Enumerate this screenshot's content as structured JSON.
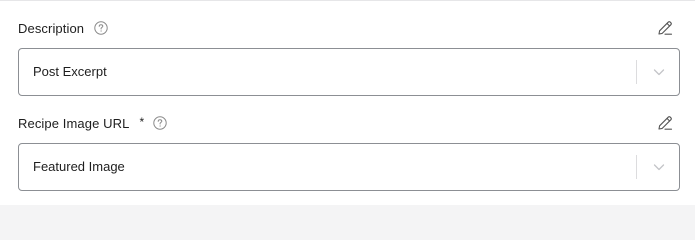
{
  "fields": [
    {
      "label": "Description",
      "required": false,
      "value": "Post Excerpt",
      "help_icon": "question-circle-icon",
      "edit_icon": "pencil-icon",
      "dropdown_icon": "chevron-down-icon"
    },
    {
      "label": "Recipe Image URL",
      "required": true,
      "required_marker": "*",
      "value": "Featured Image",
      "help_icon": "question-circle-icon",
      "edit_icon": "pencil-icon",
      "dropdown_icon": "chevron-down-icon"
    }
  ],
  "colors": {
    "text": "#1e1e1e",
    "border": "#8c8f94",
    "icon": "#757575",
    "divider": "#dcdcde"
  }
}
